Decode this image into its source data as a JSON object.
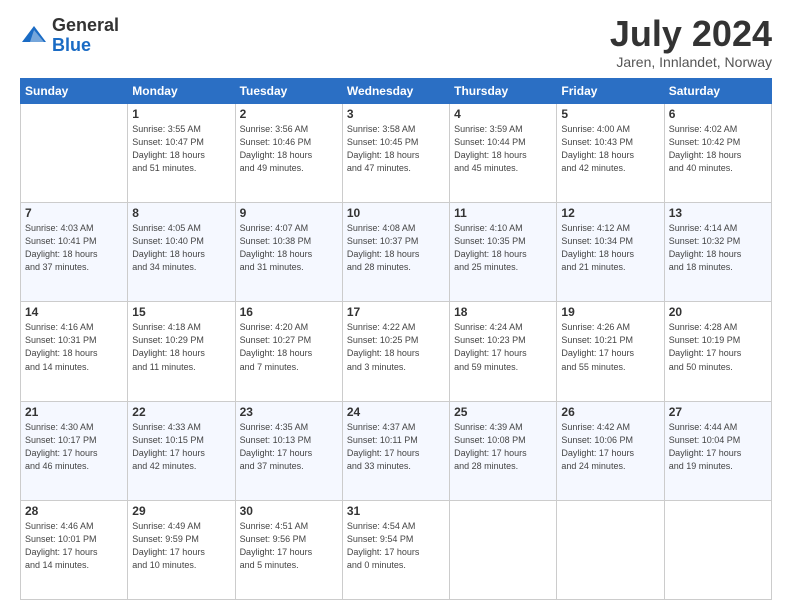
{
  "header": {
    "logo_general": "General",
    "logo_blue": "Blue",
    "month_title": "July 2024",
    "location": "Jaren, Innlandet, Norway"
  },
  "days_of_week": [
    "Sunday",
    "Monday",
    "Tuesday",
    "Wednesday",
    "Thursday",
    "Friday",
    "Saturday"
  ],
  "weeks": [
    [
      {
        "day": "",
        "info": ""
      },
      {
        "day": "1",
        "info": "Sunrise: 3:55 AM\nSunset: 10:47 PM\nDaylight: 18 hours\nand 51 minutes."
      },
      {
        "day": "2",
        "info": "Sunrise: 3:56 AM\nSunset: 10:46 PM\nDaylight: 18 hours\nand 49 minutes."
      },
      {
        "day": "3",
        "info": "Sunrise: 3:58 AM\nSunset: 10:45 PM\nDaylight: 18 hours\nand 47 minutes."
      },
      {
        "day": "4",
        "info": "Sunrise: 3:59 AM\nSunset: 10:44 PM\nDaylight: 18 hours\nand 45 minutes."
      },
      {
        "day": "5",
        "info": "Sunrise: 4:00 AM\nSunset: 10:43 PM\nDaylight: 18 hours\nand 42 minutes."
      },
      {
        "day": "6",
        "info": "Sunrise: 4:02 AM\nSunset: 10:42 PM\nDaylight: 18 hours\nand 40 minutes."
      }
    ],
    [
      {
        "day": "7",
        "info": "Sunrise: 4:03 AM\nSunset: 10:41 PM\nDaylight: 18 hours\nand 37 minutes."
      },
      {
        "day": "8",
        "info": "Sunrise: 4:05 AM\nSunset: 10:40 PM\nDaylight: 18 hours\nand 34 minutes."
      },
      {
        "day": "9",
        "info": "Sunrise: 4:07 AM\nSunset: 10:38 PM\nDaylight: 18 hours\nand 31 minutes."
      },
      {
        "day": "10",
        "info": "Sunrise: 4:08 AM\nSunset: 10:37 PM\nDaylight: 18 hours\nand 28 minutes."
      },
      {
        "day": "11",
        "info": "Sunrise: 4:10 AM\nSunset: 10:35 PM\nDaylight: 18 hours\nand 25 minutes."
      },
      {
        "day": "12",
        "info": "Sunrise: 4:12 AM\nSunset: 10:34 PM\nDaylight: 18 hours\nand 21 minutes."
      },
      {
        "day": "13",
        "info": "Sunrise: 4:14 AM\nSunset: 10:32 PM\nDaylight: 18 hours\nand 18 minutes."
      }
    ],
    [
      {
        "day": "14",
        "info": "Sunrise: 4:16 AM\nSunset: 10:31 PM\nDaylight: 18 hours\nand 14 minutes."
      },
      {
        "day": "15",
        "info": "Sunrise: 4:18 AM\nSunset: 10:29 PM\nDaylight: 18 hours\nand 11 minutes."
      },
      {
        "day": "16",
        "info": "Sunrise: 4:20 AM\nSunset: 10:27 PM\nDaylight: 18 hours\nand 7 minutes."
      },
      {
        "day": "17",
        "info": "Sunrise: 4:22 AM\nSunset: 10:25 PM\nDaylight: 18 hours\nand 3 minutes."
      },
      {
        "day": "18",
        "info": "Sunrise: 4:24 AM\nSunset: 10:23 PM\nDaylight: 17 hours\nand 59 minutes."
      },
      {
        "day": "19",
        "info": "Sunrise: 4:26 AM\nSunset: 10:21 PM\nDaylight: 17 hours\nand 55 minutes."
      },
      {
        "day": "20",
        "info": "Sunrise: 4:28 AM\nSunset: 10:19 PM\nDaylight: 17 hours\nand 50 minutes."
      }
    ],
    [
      {
        "day": "21",
        "info": "Sunrise: 4:30 AM\nSunset: 10:17 PM\nDaylight: 17 hours\nand 46 minutes."
      },
      {
        "day": "22",
        "info": "Sunrise: 4:33 AM\nSunset: 10:15 PM\nDaylight: 17 hours\nand 42 minutes."
      },
      {
        "day": "23",
        "info": "Sunrise: 4:35 AM\nSunset: 10:13 PM\nDaylight: 17 hours\nand 37 minutes."
      },
      {
        "day": "24",
        "info": "Sunrise: 4:37 AM\nSunset: 10:11 PM\nDaylight: 17 hours\nand 33 minutes."
      },
      {
        "day": "25",
        "info": "Sunrise: 4:39 AM\nSunset: 10:08 PM\nDaylight: 17 hours\nand 28 minutes."
      },
      {
        "day": "26",
        "info": "Sunrise: 4:42 AM\nSunset: 10:06 PM\nDaylight: 17 hours\nand 24 minutes."
      },
      {
        "day": "27",
        "info": "Sunrise: 4:44 AM\nSunset: 10:04 PM\nDaylight: 17 hours\nand 19 minutes."
      }
    ],
    [
      {
        "day": "28",
        "info": "Sunrise: 4:46 AM\nSunset: 10:01 PM\nDaylight: 17 hours\nand 14 minutes."
      },
      {
        "day": "29",
        "info": "Sunrise: 4:49 AM\nSunset: 9:59 PM\nDaylight: 17 hours\nand 10 minutes."
      },
      {
        "day": "30",
        "info": "Sunrise: 4:51 AM\nSunset: 9:56 PM\nDaylight: 17 hours\nand 5 minutes."
      },
      {
        "day": "31",
        "info": "Sunrise: 4:54 AM\nSunset: 9:54 PM\nDaylight: 17 hours\nand 0 minutes."
      },
      {
        "day": "",
        "info": ""
      },
      {
        "day": "",
        "info": ""
      },
      {
        "day": "",
        "info": ""
      }
    ]
  ]
}
